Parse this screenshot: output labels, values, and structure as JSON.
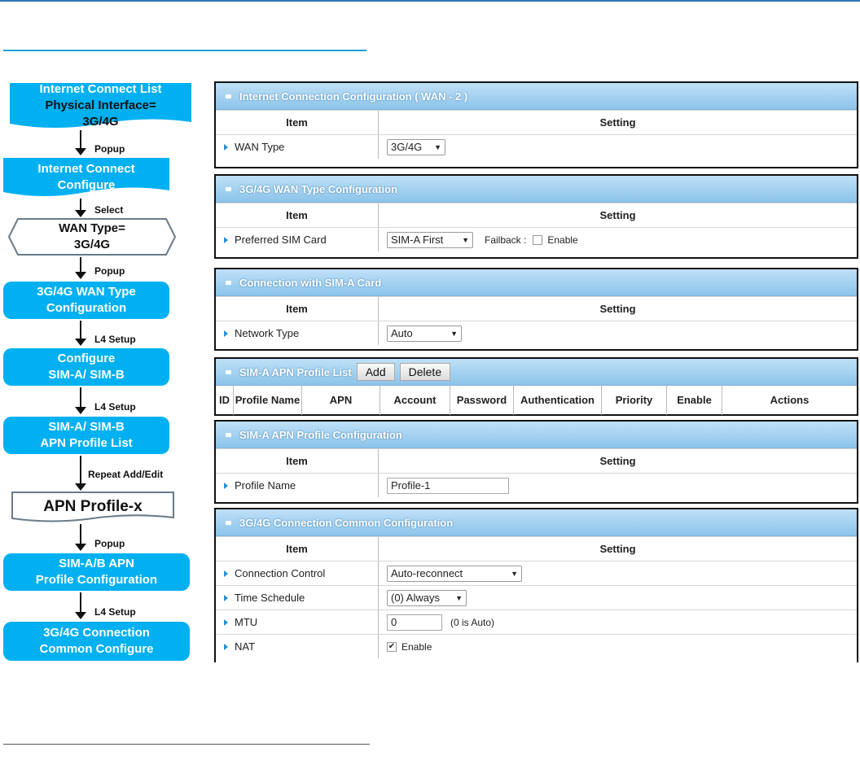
{
  "flowchart": {
    "box1": {
      "line1": "Internet Connect  List",
      "line2": "Physical Interface=",
      "line3": "3G/4G"
    },
    "arrow1": "Popup",
    "box2": {
      "line1": "Internet Connect",
      "line2": "Configure"
    },
    "arrow2": "Select",
    "box3": {
      "line1": "WAN Type=",
      "line2": "3G/4G"
    },
    "arrow3": "Popup",
    "box4": {
      "line1": "3G/4G WAN Type",
      "line2": "Configuration"
    },
    "arrow4": "L4 Setup",
    "box5": {
      "line1": "Configure",
      "line2": "SIM-A/ SIM-B"
    },
    "arrow5": "L4 Setup",
    "box6": {
      "line1": "SIM-A/ SIM-B",
      "line2": "APN Profile  List"
    },
    "arrow6": "Repeat Add/Edit",
    "box7": {
      "line1": "APN Profile-x"
    },
    "arrow7": "Popup",
    "box8": {
      "line1": "SIM-A/B APN",
      "line2": "Profile Configuration"
    },
    "arrow8": "L4 Setup",
    "box9": {
      "line1": "3G/4G Connection",
      "line2": "Common Configure"
    }
  },
  "sections": {
    "wan": {
      "title": "Internet Connection Configuration ( WAN - 2 )",
      "col_item": "Item",
      "col_setting": "Setting",
      "wan_type_label": "WAN Type",
      "wan_type_value": "3G/4G"
    },
    "wan_type_cfg": {
      "title": "3G/4G WAN Type Configuration",
      "col_item": "Item",
      "col_setting": "Setting",
      "sim_label": "Preferred SIM Card",
      "sim_value": "SIM-A First",
      "failback_label": "Failback :",
      "enable_label": "Enable"
    },
    "sim_a": {
      "title": "Connection with SIM-A Card",
      "col_item": "Item",
      "col_setting": "Setting",
      "net_label": "Network Type",
      "net_value": "Auto"
    },
    "apn_list": {
      "title": "SIM-A APN Profile List",
      "add": "Add",
      "delete": "Delete",
      "columns": [
        "ID",
        "Profile Name",
        "APN",
        "Account",
        "Password",
        "Authentication",
        "Priority",
        "Enable",
        "Actions"
      ]
    },
    "apn_cfg": {
      "title": "SIM-A APN Profile Configuration",
      "col_item": "Item",
      "col_setting": "Setting",
      "profile_label": "Profile Name",
      "profile_value": "Profile-1"
    },
    "common": {
      "title": "3G/4G Connection Common Configuration",
      "col_item": "Item",
      "col_setting": "Setting",
      "conn_label": "Connection Control",
      "conn_value": "Auto-reconnect",
      "sched_label": "Time Schedule",
      "sched_value": "(0) Always",
      "mtu_label": "MTU",
      "mtu_value": "0",
      "mtu_note": "(0 is Auto)",
      "nat_label": "NAT",
      "nat_enable": "Enable"
    }
  }
}
